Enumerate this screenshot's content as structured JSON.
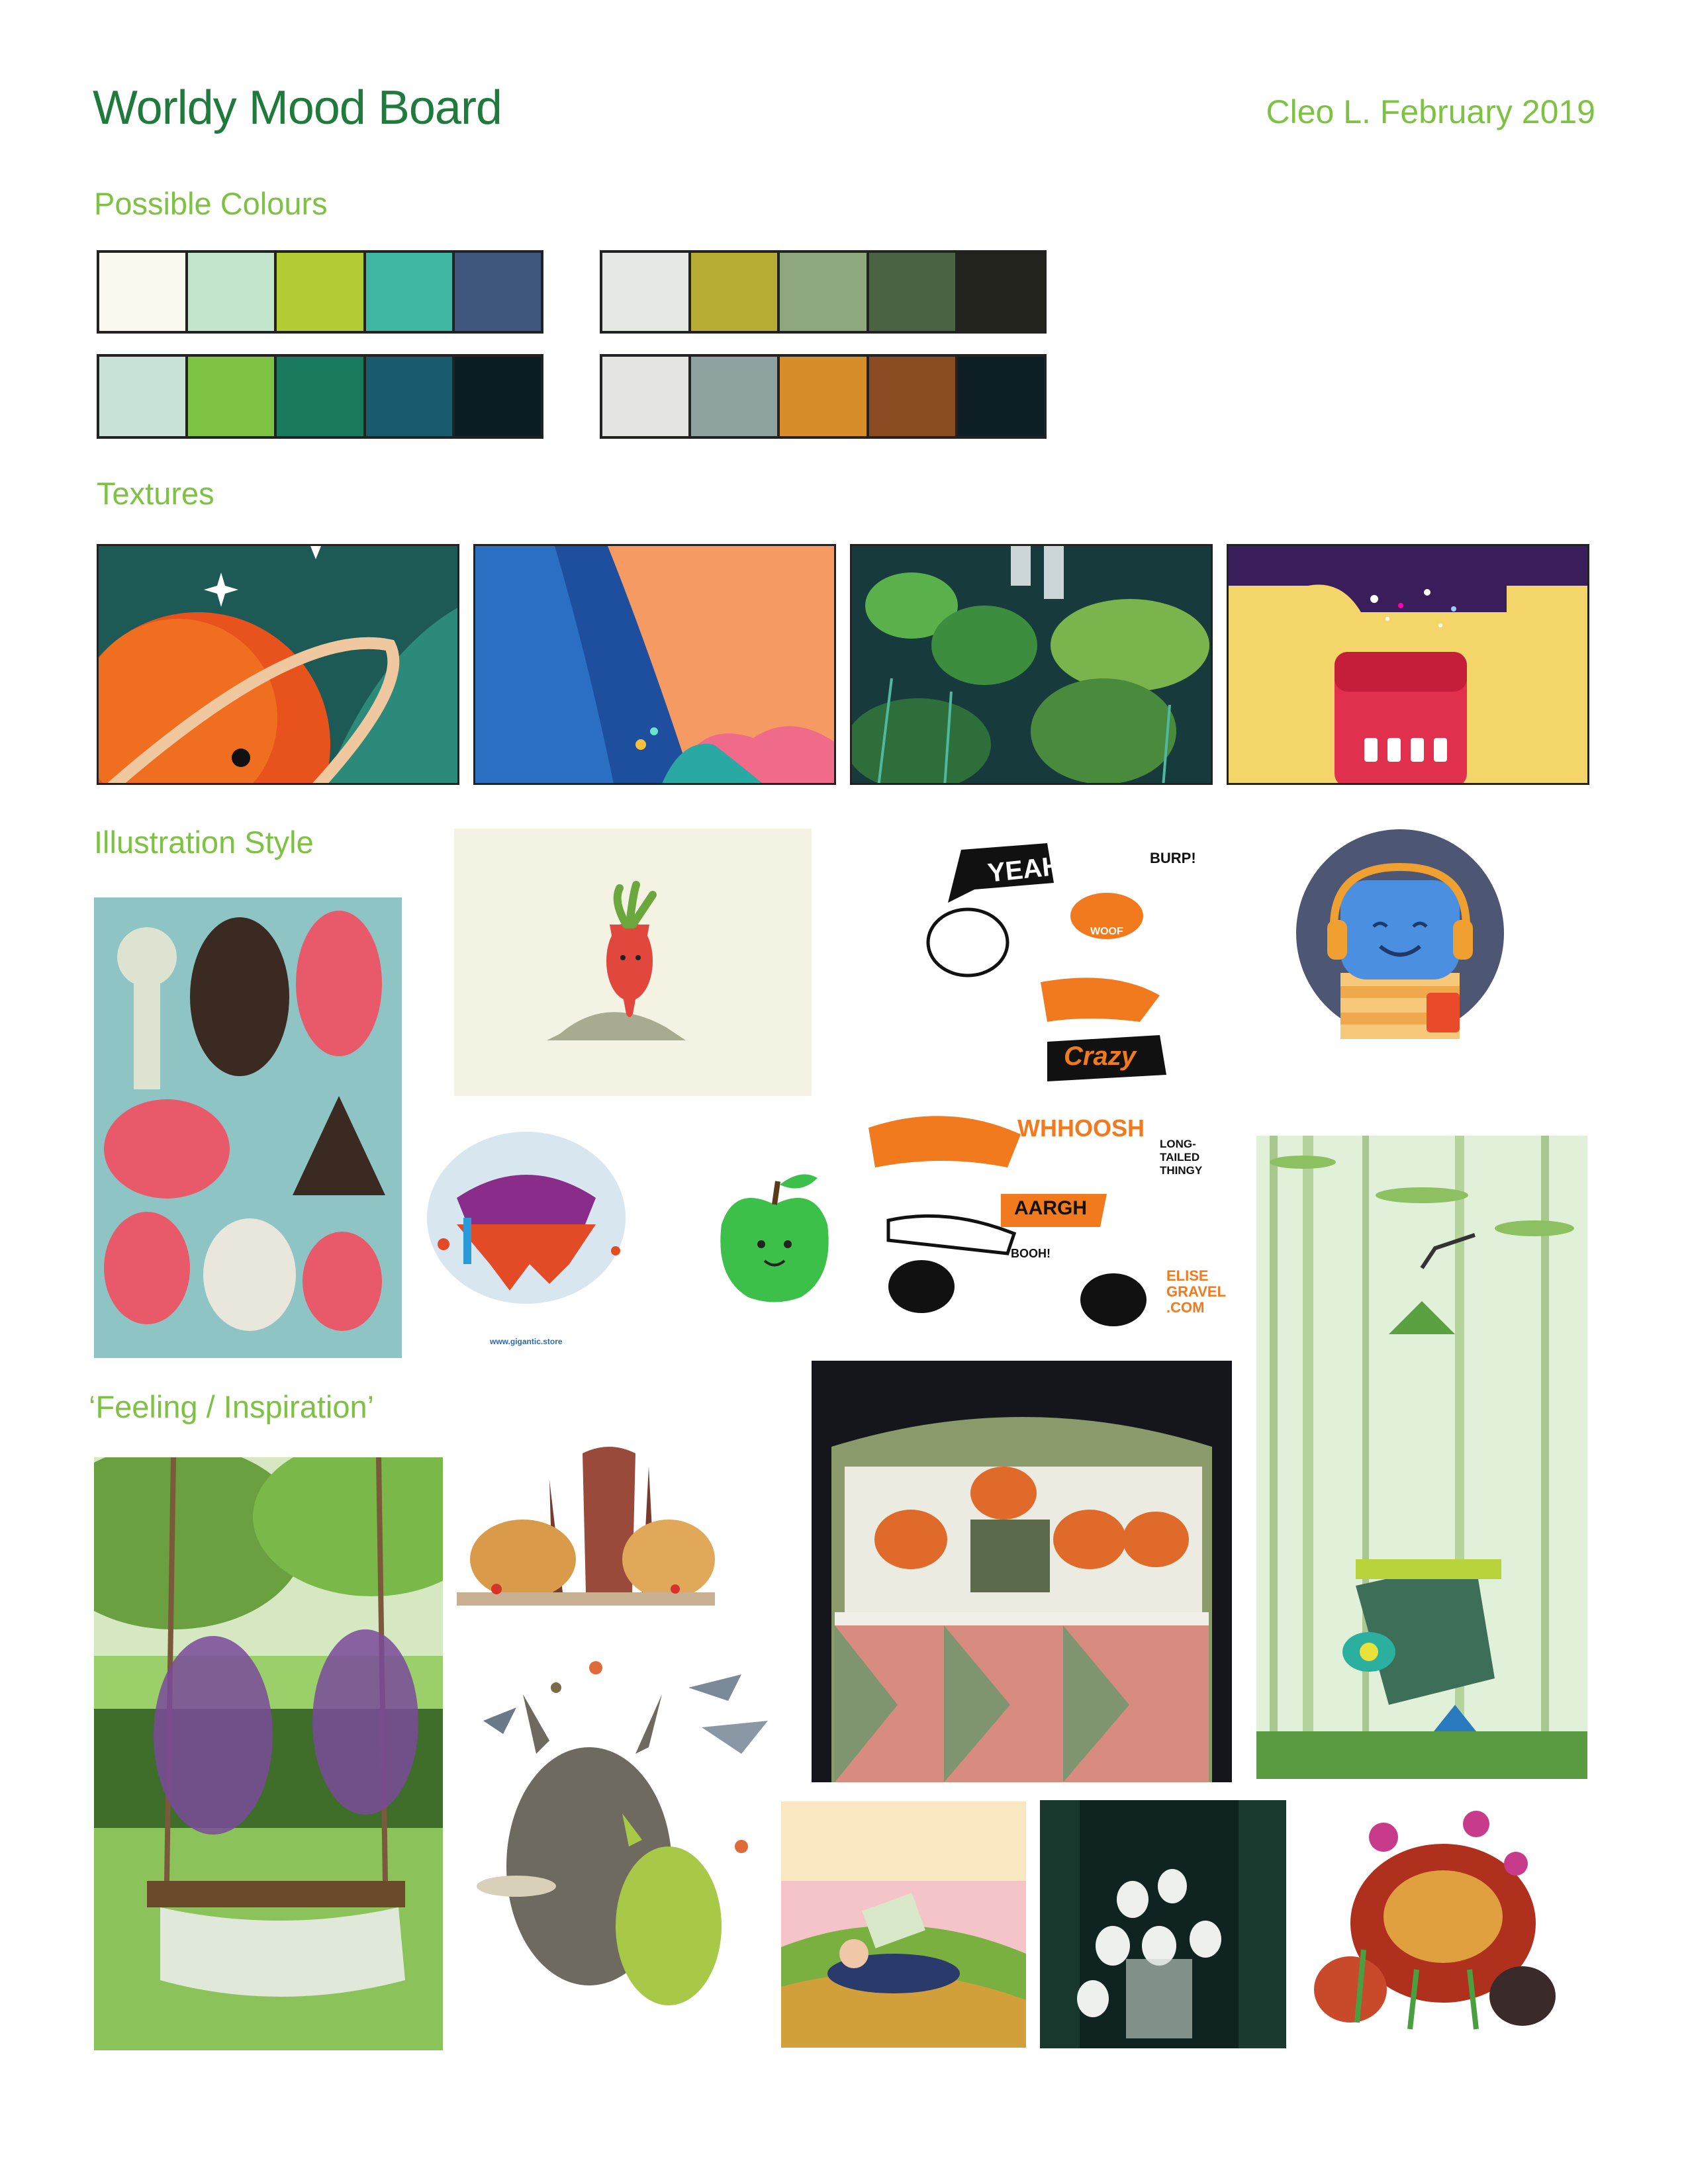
{
  "header": {
    "title": "Worldy Mood Board",
    "author_date": "Cleo L. February 2019"
  },
  "sections": {
    "colours": "Possible Colours",
    "textures": "Textures",
    "illustration": "Illustration Style",
    "feeling": "‘Feeling / Inspiration’"
  },
  "palettes": [
    [
      "#fbf9ef",
      "#c2e5cc",
      "#b4cc34",
      "#3fb7a3",
      "#3f567f"
    ],
    [
      "#e5e9e3",
      "#b8ad34",
      "#8ea77c",
      "#4a6443",
      "#21231c"
    ],
    [
      "#c9e3d9",
      "#7dc242",
      "#1a7a5e",
      "#1a5a6d",
      "#0a1d22"
    ],
    [
      "#e4e5e0",
      "#8ea3a0",
      "#d68d2a",
      "#8a4b22",
      "#0d1f24"
    ]
  ],
  "illustration_text": {
    "gigantic": "www.gigantic.store",
    "yeah": "YEAH",
    "burp": "BURP!",
    "woof": "WOOF",
    "crazy": "Crazy",
    "whoosh": "WHHOOSH",
    "long_tailed": "LONG-TAILED THINGY",
    "aargh": "AARGH",
    "booh": "BOOH!",
    "elise": "ELISE GRAVEL .COM"
  },
  "colors": {
    "heading_dark_green": "#1f7a3c",
    "heading_light_green": "#7dc242"
  }
}
